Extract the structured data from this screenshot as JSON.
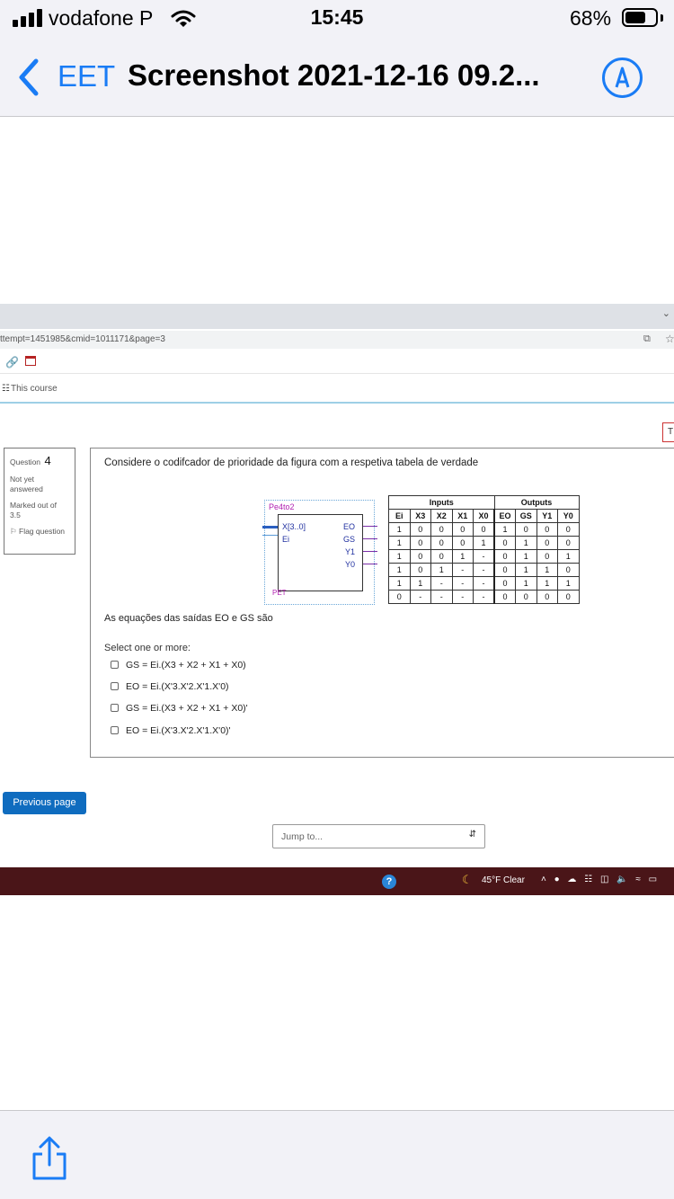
{
  "status_bar": {
    "carrier": "vodafone P",
    "time": "15:45",
    "battery_percent": "68%",
    "battery_level": 0.68,
    "signal_bars": 4
  },
  "nav_bar": {
    "back_label": "EET",
    "title": "Screenshot 2021-12-16 09.2..."
  },
  "browser": {
    "url": "ttempt=1451985&cmid=1011171&page=3",
    "breadcrumb": "This course",
    "tab_partial": "T"
  },
  "question_info": {
    "label": "Question",
    "number": "4",
    "status": "Not yet answered",
    "marked": "Marked out of 3.5",
    "flag": "Flag question"
  },
  "question": {
    "text": "Considere o codifcador de prioridade da figura com a respetiva tabela de verdade",
    "prompt": "As equações  das saídas EO e GS são",
    "select_label": "Select one or more:"
  },
  "block": {
    "name": "Pe4to2",
    "in_x": "X[3..0]",
    "in_ei": "Ei",
    "out_eo": "EO",
    "out_gs": "GS",
    "out_y1": "Y1",
    "out_y0": "Y0",
    "footer": "PET"
  },
  "truth_table": {
    "group_inputs": "Inputs",
    "group_outputs": "Outputs",
    "headers": [
      "Ei",
      "X3",
      "X2",
      "X1",
      "X0",
      "EO",
      "GS",
      "Y1",
      "Y0"
    ],
    "rows": [
      [
        "1",
        "0",
        "0",
        "0",
        "0",
        "1",
        "0",
        "0",
        "0"
      ],
      [
        "1",
        "0",
        "0",
        "0",
        "1",
        "0",
        "1",
        "0",
        "0"
      ],
      [
        "1",
        "0",
        "0",
        "1",
        "-",
        "0",
        "1",
        "0",
        "1"
      ],
      [
        "1",
        "0",
        "1",
        "-",
        "-",
        "0",
        "1",
        "1",
        "0"
      ],
      [
        "1",
        "1",
        "-",
        "-",
        "-",
        "0",
        "1",
        "1",
        "1"
      ],
      [
        "0",
        "-",
        "-",
        "-",
        "-",
        "0",
        "0",
        "0",
        "0"
      ]
    ]
  },
  "options": [
    "GS = Ei.(X3 + X2 + X1 + X0)",
    "EO = Ei.(X'3.X'2.X'1.X'0)",
    "GS = Ei.(X3 + X2 + X1 + X0)'",
    "EO = Ei.(X'3.X'2.X'1.X'0)'"
  ],
  "navigation": {
    "previous": "Previous page",
    "jump_placeholder": "Jump to..."
  },
  "taskbar": {
    "weather": "45°F  Clear",
    "help": "?"
  },
  "colors": {
    "ios_blue": "#1a7cf5",
    "moodle_blue": "#0f6cbf",
    "taskbar": "#4a1518",
    "block_label": "#b01fb0"
  }
}
